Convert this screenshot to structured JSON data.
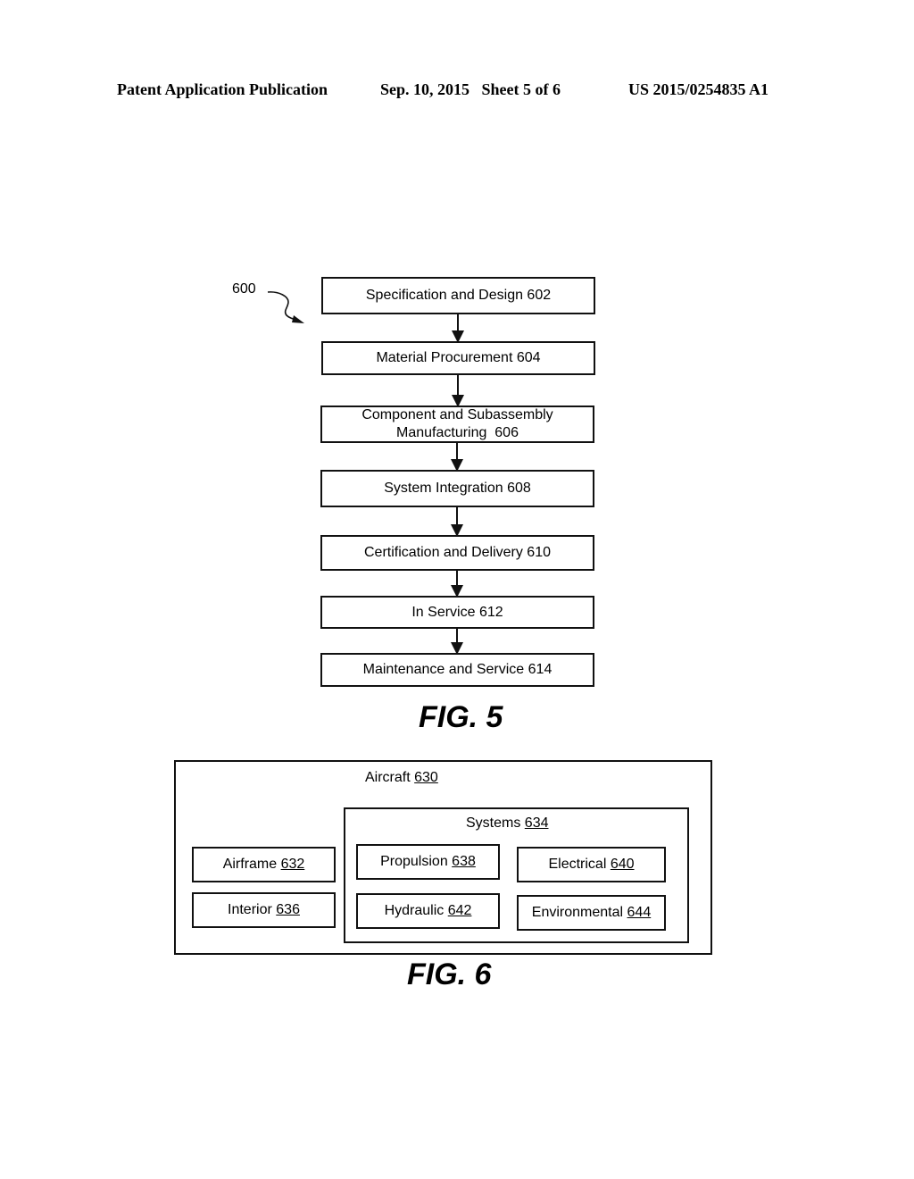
{
  "header": {
    "publication": "Patent Application Publication",
    "date_sheet": "Sep. 10, 2015   Sheet 5 of 6",
    "patent_number": "US 2015/0254835 A1"
  },
  "fig5": {
    "ref_label": "600",
    "steps": [
      {
        "text": "Specification and Design 602"
      },
      {
        "text": "Material Procurement 604"
      },
      {
        "line1": "Component and Subassembly",
        "line2": "Manufacturing  606"
      },
      {
        "text": "System Integration 608"
      },
      {
        "text": "Certification and Delivery 610"
      },
      {
        "text": "In Service 612"
      },
      {
        "text": "Maintenance and Service 614"
      }
    ],
    "caption": "FIG. 5"
  },
  "fig6": {
    "aircraft": {
      "name": "Aircraft",
      "num": "630"
    },
    "systems": {
      "name": "Systems",
      "num": "634"
    },
    "airframe": {
      "name": "Airframe",
      "num": "632"
    },
    "interior": {
      "name": "Interior",
      "num": "636"
    },
    "propulsion": {
      "name": "Propulsion",
      "num": "638"
    },
    "electrical": {
      "name": "Electrical",
      "num": "640"
    },
    "hydraulic": {
      "name": "Hydraulic",
      "num": "642"
    },
    "environmental": {
      "name": "Environmental",
      "num": "644"
    },
    "caption": "FIG. 6"
  }
}
